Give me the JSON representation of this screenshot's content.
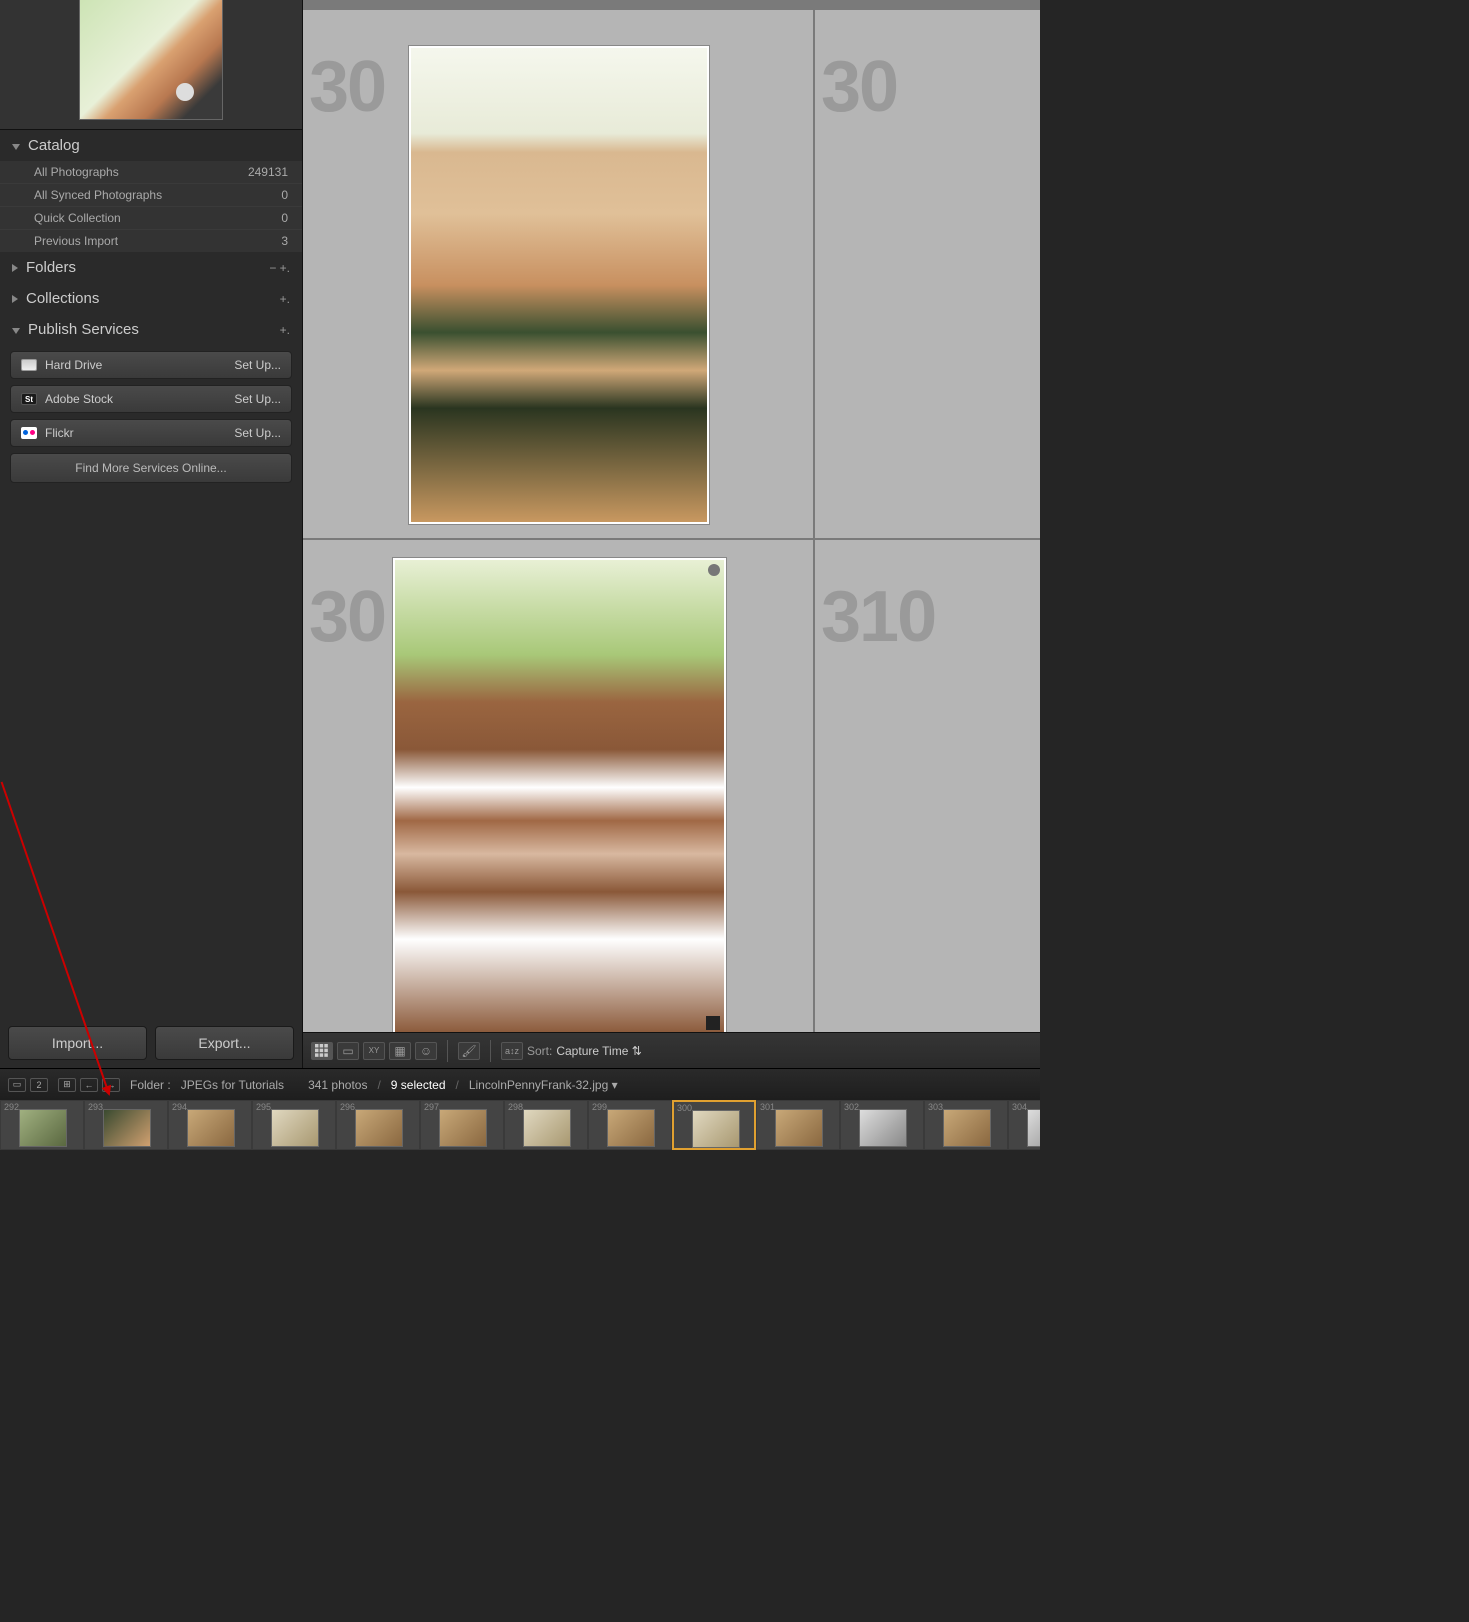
{
  "sidebar": {
    "catalog": {
      "title": "Catalog",
      "items": [
        {
          "label": "All Photographs",
          "count": "249131"
        },
        {
          "label": "All Synced Photographs",
          "count": "0"
        },
        {
          "label": "Quick Collection",
          "count": "0"
        },
        {
          "label": "Previous Import",
          "count": "3"
        }
      ]
    },
    "folders": {
      "title": "Folders",
      "actions": "− +."
    },
    "collections": {
      "title": "Collections",
      "actions": "+."
    },
    "publish": {
      "title": "Publish Services",
      "actions": "+.",
      "services": [
        {
          "name": "Hard Drive",
          "action": "Set Up...",
          "icon": "hd"
        },
        {
          "name": "Adobe Stock",
          "action": "Set Up...",
          "icon": "st",
          "icon_text": "St"
        },
        {
          "name": "Flickr",
          "action": "Set Up...",
          "icon": "fl"
        }
      ],
      "find_label": "Find More Services Online..."
    },
    "import_label": "Import...",
    "export_label": "Export..."
  },
  "grid": {
    "cells": [
      {
        "num": "30"
      },
      {
        "num": "30"
      },
      {
        "num": "30"
      },
      {
        "num": "310"
      }
    ]
  },
  "toolbar": {
    "sort_label": "Sort:",
    "sort_value": "Capture Time"
  },
  "status": {
    "badge": "2",
    "folder_label": "Folder :",
    "folder_name": "JPEGs for Tutorials",
    "count_text": "341 photos",
    "selected_text": "9 selected",
    "filename": "LincolnPennyFrank-32.jpg ▾"
  },
  "filmstrip": {
    "items": [
      {
        "num": "292",
        "cls": "fs-a",
        "sel": false
      },
      {
        "num": "293",
        "cls": "fs-b",
        "sel": false
      },
      {
        "num": "294",
        "cls": "fs-c",
        "sel": false
      },
      {
        "num": "295",
        "cls": "fs-d",
        "sel": false
      },
      {
        "num": "296",
        "cls": "fs-c",
        "sel": false
      },
      {
        "num": "297",
        "cls": "fs-c",
        "sel": false
      },
      {
        "num": "298",
        "cls": "fs-d",
        "sel": false
      },
      {
        "num": "299",
        "cls": "fs-c",
        "sel": false
      },
      {
        "num": "300",
        "cls": "fs-d",
        "sel": true
      },
      {
        "num": "301",
        "cls": "fs-c",
        "sel": false
      },
      {
        "num": "302",
        "cls": "fs-e",
        "sel": false
      },
      {
        "num": "303",
        "cls": "fs-c",
        "sel": false
      },
      {
        "num": "304",
        "cls": "fs-e",
        "sel": false
      }
    ]
  }
}
